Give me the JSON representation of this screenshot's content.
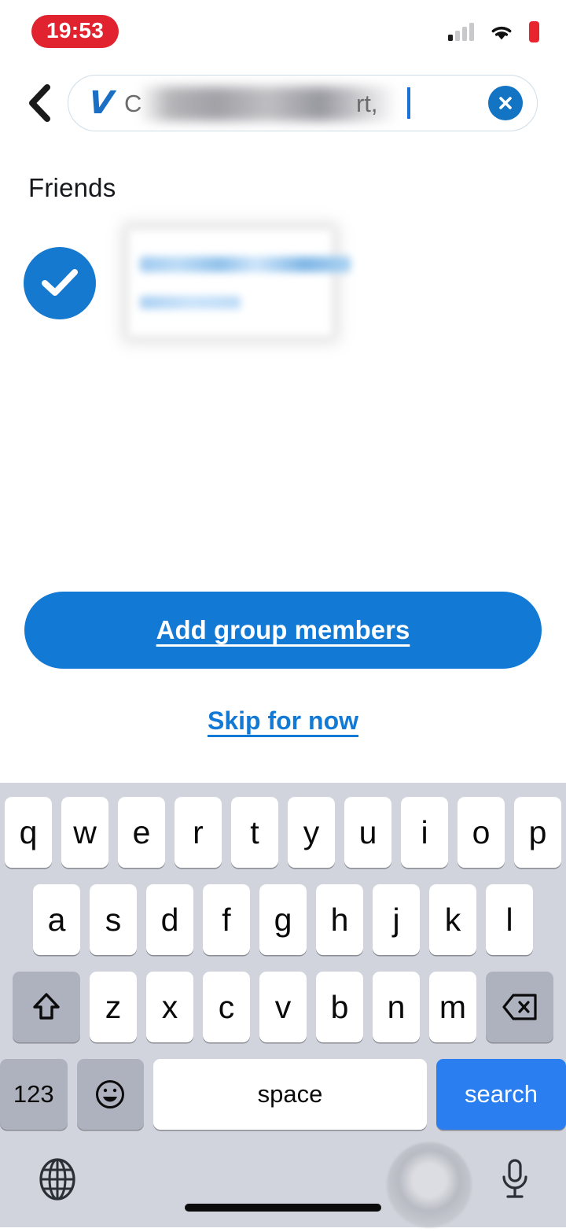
{
  "status_bar": {
    "time": "19:53",
    "signal_icon": "cellular-signal-icon",
    "signal_bars_total": 4,
    "signal_bars_filled": 1,
    "wifi_icon": "wifi-icon",
    "battery_icon": "battery-icon",
    "battery_color": "#e8252f",
    "time_pill_color": "#e0232e"
  },
  "header": {
    "back_icon": "back-chevron-icon",
    "logo": "venmo-v-logo",
    "logo_text": "V",
    "search_value_visible": "C",
    "search_value_tail": "rt,",
    "clear_icon": "close-circle-icon",
    "caret_color": "#1b72d6"
  },
  "friends": {
    "section_title": "Friends",
    "rows": [
      {
        "selected": true,
        "check_icon": "checkmark-icon",
        "name": "",
        "handle": ""
      }
    ]
  },
  "cta": {
    "primary_label": "Add group members",
    "secondary_label": "Skip for now",
    "primary_color": "#1279d4"
  },
  "keyboard": {
    "row1": [
      "q",
      "w",
      "e",
      "r",
      "t",
      "y",
      "u",
      "i",
      "o",
      "p"
    ],
    "row2": [
      "a",
      "s",
      "d",
      "f",
      "g",
      "h",
      "j",
      "k",
      "l"
    ],
    "row3": [
      "z",
      "x",
      "c",
      "v",
      "b",
      "n",
      "m"
    ],
    "shift_icon": "shift-arrow-icon",
    "backspace_icon": "backspace-icon",
    "numbers_label": "123",
    "emoji_icon": "emoji-smiley-icon",
    "space_label": "space",
    "search_label": "search",
    "search_key_color": "#2a7ef0",
    "globe_icon": "globe-icon",
    "mic_icon": "microphone-icon",
    "assistive_touch_icon": "assistive-touch-icon",
    "home_indicator": "home-indicator"
  }
}
